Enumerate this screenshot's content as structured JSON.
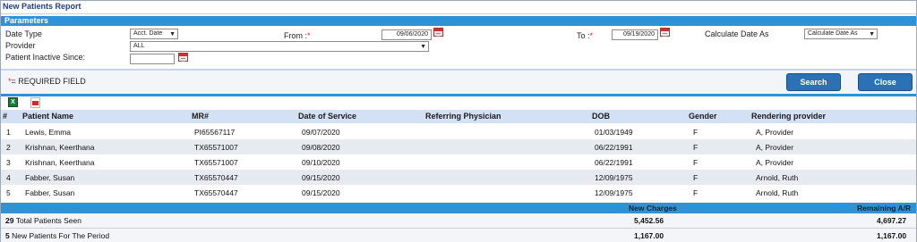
{
  "title": "New Patients Report",
  "params": {
    "header": "Parameters",
    "date_type_label": "Date Type",
    "date_type_value": "Acct. Date",
    "from_label": "From :",
    "from_value": "09/06/2020",
    "to_label": "To :",
    "to_value": "09/19/2020",
    "calc_label": "Calculate Date As",
    "calc_value": "Calculate Date As",
    "provider_label": "Provider",
    "provider_value": "ALL",
    "inactive_label": "Patient Inactive Since:",
    "inactive_value": "",
    "required_star": "*",
    "required_text": "= REQUIRED FIELD"
  },
  "buttons": {
    "search": "Search",
    "close": "Close"
  },
  "toolbar": {
    "excel_icon": "excel-icon",
    "pdf_icon": "pdf-icon",
    "excel_glyph": "X"
  },
  "table": {
    "headers": [
      "#",
      "Patient Name",
      "MR#",
      "Date of Service",
      "Referring Physician",
      "DOB",
      "Gender",
      "Rendering provider"
    ],
    "rows": [
      [
        "1",
        "Lewis, Emma",
        "PI65567117",
        "09/07/2020",
        "",
        "01/03/1949",
        "F",
        "A, Provider"
      ],
      [
        "2",
        "Krishnan, Keerthana",
        "TX65571007",
        "09/08/2020",
        "",
        "06/22/1991",
        "F",
        "A, Provider"
      ],
      [
        "3",
        "Krishnan, Keerthana",
        "TX65571007",
        "09/10/2020",
        "",
        "06/22/1991",
        "F",
        "A, Provider"
      ],
      [
        "4",
        "Fabber, Susan",
        "TX65570447",
        "09/15/2020",
        "",
        "12/09/1975",
        "F",
        "Arnold, Ruth"
      ],
      [
        "5",
        "Fabber, Susan",
        "TX65570447",
        "09/15/2020",
        "",
        "12/09/1975",
        "F",
        "Arnold, Ruth"
      ]
    ]
  },
  "summary": {
    "new_charges_label": "New Charges",
    "remaining_ar_label": "Remaining A/R",
    "total_count": "29",
    "total_label": "Total Patients Seen",
    "total_charges": "5,452.56",
    "total_ar": "4,697.27",
    "new_count": "5",
    "new_label": "New Patients For The Period",
    "new_charges": "1,167.00",
    "new_ar": "1,167.00"
  }
}
